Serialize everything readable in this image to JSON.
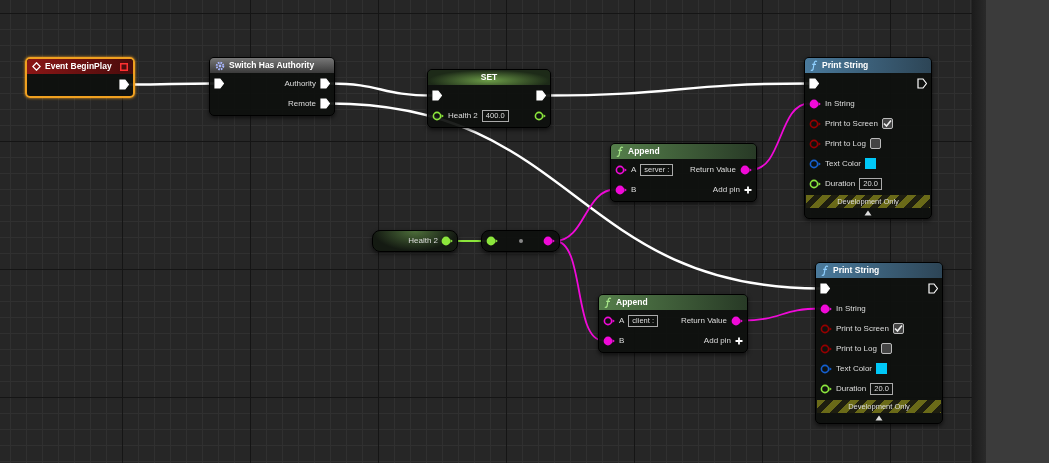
{
  "nodes": [
    {
      "kind": "event",
      "title": "Event BeginPlay",
      "selected": true,
      "outputs": [
        {
          "kind": "exec",
          "connected": true
        }
      ]
    },
    {
      "kind": "macro",
      "title": "Switch Has Authority",
      "selected": false,
      "inputs": [
        {
          "kind": "exec",
          "connected": true
        }
      ],
      "outputs": [
        {
          "kind": "exec",
          "label": "Authority",
          "connected": true
        },
        {
          "kind": "exec",
          "label": "Remote",
          "connected": true
        }
      ]
    },
    {
      "kind": "set",
      "title": "SET",
      "selected": false,
      "inputs": [
        {
          "kind": "exec",
          "connected": true
        },
        {
          "kind": "float",
          "label": "Health 2",
          "value": "400.0",
          "connected": false
        }
      ],
      "outputs": [
        {
          "kind": "exec",
          "connected": true
        },
        {
          "kind": "float",
          "connected": false
        }
      ]
    },
    {
      "kind": "print",
      "title": "Print String",
      "selected": false,
      "footer": "Development Only",
      "inputs": [
        {
          "kind": "exec",
          "connected": true
        },
        {
          "kind": "string",
          "label": "In String",
          "connected": true
        },
        {
          "kind": "bool",
          "label": "Print to Screen",
          "checked": true,
          "connected": false
        },
        {
          "kind": "bool",
          "label": "Print to Log",
          "checked": false,
          "connected": false
        },
        {
          "kind": "color",
          "label": "Text Color",
          "color": "#00c8f8",
          "connected": false
        },
        {
          "kind": "float",
          "label": "Duration",
          "value": "20.0",
          "connected": false
        }
      ],
      "outputs": [
        {
          "kind": "exec",
          "connected": false
        }
      ]
    },
    {
      "kind": "function",
      "title": "Append",
      "selected": false,
      "inputs": [
        {
          "kind": "string",
          "label": "A",
          "value": "server :",
          "connected": false
        },
        {
          "kind": "string",
          "label": "B",
          "connected": true
        }
      ],
      "outputs": [
        {
          "kind": "string",
          "label": "Return Value",
          "connected": true
        },
        {
          "kind": "add",
          "label": "Add pin"
        }
      ]
    },
    {
      "kind": "getter",
      "title": "Health 2",
      "selected": false,
      "outputs": [
        {
          "kind": "float",
          "connected": true
        }
      ]
    },
    {
      "kind": "convert",
      "selected": false,
      "inputs": [
        {
          "kind": "float",
          "connected": true
        }
      ],
      "outputs": [
        {
          "kind": "string",
          "connected": true
        }
      ]
    },
    {
      "kind": "function",
      "title": "Append",
      "selected": false,
      "inputs": [
        {
          "kind": "string",
          "label": "A",
          "value": "client :",
          "connected": false
        },
        {
          "kind": "string",
          "label": "B",
          "connected": true
        }
      ],
      "outputs": [
        {
          "kind": "string",
          "label": "Return Value",
          "connected": true
        },
        {
          "kind": "add",
          "label": "Add pin"
        }
      ]
    },
    {
      "kind": "print",
      "title": "Print String",
      "selected": false,
      "footer": "Development Only",
      "inputs": [
        {
          "kind": "exec",
          "connected": true
        },
        {
          "kind": "string",
          "label": "In String",
          "connected": true
        },
        {
          "kind": "bool",
          "label": "Print to Screen",
          "checked": true,
          "connected": false
        },
        {
          "kind": "bool",
          "label": "Print to Log",
          "checked": false,
          "connected": false
        },
        {
          "kind": "color",
          "label": "Text Color",
          "color": "#00c8f8",
          "connected": false
        },
        {
          "kind": "float",
          "label": "Duration",
          "value": "20.0",
          "connected": false
        }
      ],
      "outputs": [
        {
          "kind": "exec",
          "connected": false
        }
      ]
    }
  ]
}
